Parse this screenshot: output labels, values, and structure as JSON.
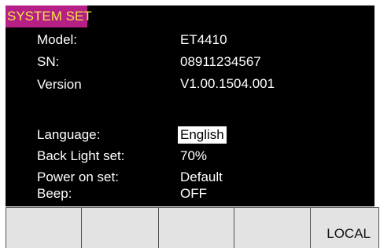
{
  "title": "SYSTEM SET",
  "info": {
    "model_label": "Model:",
    "model_value": "ET4410",
    "sn_label": "SN:",
    "sn_value": "08911234567",
    "version_label": "Version",
    "version_value": "V1.00.1504.001"
  },
  "settings": {
    "language_label": "Language:",
    "language_value": "English",
    "backlight_label": "Back Light set:",
    "backlight_value": "70%",
    "poweron_label": "Power on set:",
    "poweron_value": "Default",
    "beep_label": "Beep:",
    "beep_value": "OFF"
  },
  "softkeys": [
    "",
    "",
    "",
    "",
    "LOCAL"
  ],
  "colors": {
    "title_bg": "#b51f86",
    "title_fg": "#f5e642",
    "screen_bg": "#000000",
    "softkey_bg": "#e3e3e3"
  }
}
